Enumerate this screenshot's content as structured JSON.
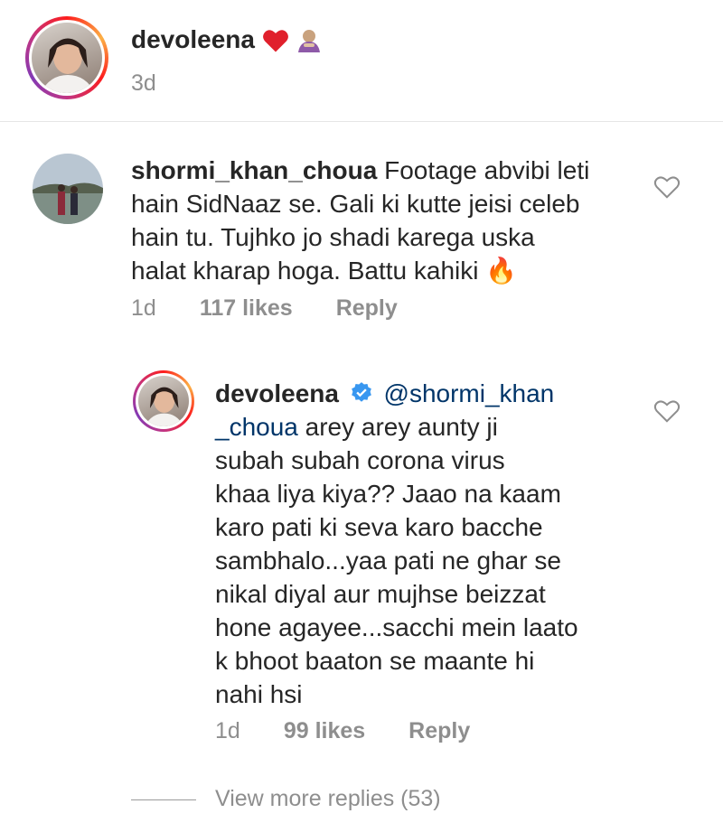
{
  "post_caption": {
    "username": "devoleena",
    "emoji_suffix": "❤️🙇",
    "timestamp": "3d"
  },
  "comments": [
    {
      "username": "shormi_khan_choua",
      "text_lines": [
        "Footage abvibi leti",
        "hain SidNaaz se. Gali ki kutte jeisi celeb",
        "hain tu. Tujhko jo shadi karega uska",
        "halat kharap hoga. Battu kahiki 🔥"
      ],
      "timestamp": "1d",
      "likes": "117 likes",
      "reply_label": "Reply"
    },
    {
      "username": "devoleena",
      "verified": true,
      "mention": "@shormi_khan",
      "mention_cont": "_choua",
      "text_lines": [
        "arey arey aunty ji",
        "subah subah corona virus",
        "khaa liya kiya?? Jaao na kaam",
        "karo pati ki seva karo bacche",
        "sambhalo...yaa pati ne ghar se",
        "nikal diyal aur mujhse beizzat",
        "hone agayee...sacchi mein laato",
        "k bhoot baaton se maante hi",
        "nahi hsi"
      ],
      "timestamp": "1d",
      "likes": "99 likes",
      "reply_label": "Reply"
    }
  ],
  "view_more_replies": "View more replies (53)",
  "colors": {
    "text": "#262626",
    "meta": "#8e8e8e",
    "mention": "#003569",
    "verified": "#3897f0"
  },
  "icons": [
    "heart-outline-icon",
    "verified-badge-icon",
    "fire-emoji",
    "heart-emoji",
    "bowing-emoji"
  ]
}
